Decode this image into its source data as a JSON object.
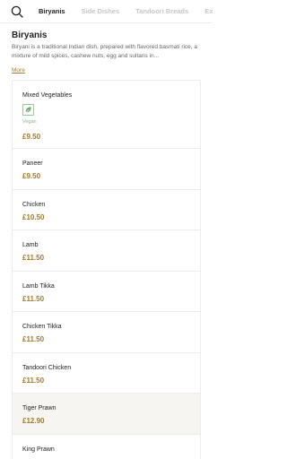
{
  "tabs": [
    "Biryanis",
    "Side Dishes",
    "Tandoori Breads",
    "Extras"
  ],
  "section": {
    "title": "Biryanis",
    "description": "Biryani is a traditional Indian dish, prepared with flavored basmati rice, a mixture of mild spices, cashew nuts, egg and sultans in...",
    "more": "More"
  },
  "items": [
    {
      "name": "Mixed Vegetables",
      "badge": "Vegan",
      "price": "£9.50"
    },
    {
      "name": "Paneer",
      "price": "£9.50"
    },
    {
      "name": "Chicken",
      "price": "£10.50"
    },
    {
      "name": "Lamb",
      "price": "£11.50"
    },
    {
      "name": "Lamb Tikka",
      "price": "£11.50"
    },
    {
      "name": "Chicken Tikka",
      "price": "£11.50"
    },
    {
      "name": "Tandoori Chicken",
      "price": "£11.50"
    },
    {
      "name": "Tiger Prawn",
      "price": "£12.90"
    },
    {
      "name": "King Prawn",
      "price": ""
    }
  ],
  "colors": {
    "accent": "#a07a2c",
    "highlight": "#f7f5f1",
    "vegan": "#6aa56a"
  },
  "icons": {
    "search": "search-icon",
    "vegan": "leaf-icon"
  }
}
